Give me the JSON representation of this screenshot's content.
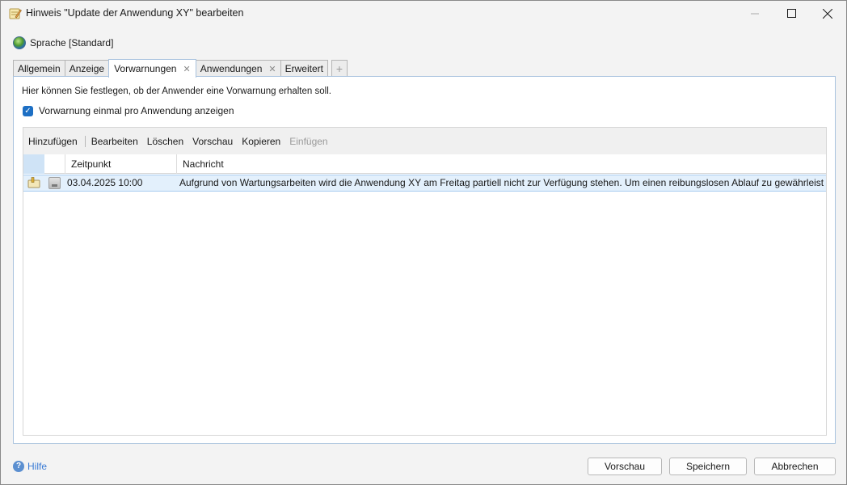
{
  "window": {
    "title": "Hinweis \"Update der Anwendung XY\" bearbeiten"
  },
  "language": {
    "label": "Sprache [Standard]"
  },
  "tabs": [
    {
      "label": "Allgemein"
    },
    {
      "label": "Anzeige"
    },
    {
      "label": "Vorwarnungen",
      "active": true,
      "closable": true
    },
    {
      "label": "Anwendungen",
      "closable": true
    },
    {
      "label": "Erweitert"
    }
  ],
  "tab_add_symbol": "+",
  "panel": {
    "hint": "Hier können Sie festlegen, ob der Anwender eine Vorwarnung erhalten soll.",
    "checkbox_label": "Vorwarnung einmal pro Anwendung anzeigen",
    "checkbox_checked": true
  },
  "toolbar": {
    "add": "Hinzufügen",
    "edit": "Bearbeiten",
    "delete": "Löschen",
    "preview": "Vorschau",
    "copy": "Kopieren",
    "paste": "Einfügen"
  },
  "table": {
    "headers": {
      "time": "Zeitpunkt",
      "message": "Nachricht"
    },
    "rows": [
      {
        "time": "03.04.2025 10:00",
        "message": "Aufgrund von Wartungsarbeiten wird die Anwendung XY am Freitag partiell nicht zur Verfügung stehen. Um einen reibungslosen Ablauf zu gewährleist...",
        "selected": true
      }
    ]
  },
  "footer": {
    "help": "Hilfe",
    "preview_button": "Vorschau",
    "save_button": "Speichern",
    "cancel_button": "Abbrechen"
  },
  "colors": {
    "accent": "#1d6fc4",
    "selection_row": "#e3f0fc",
    "link": "#3a7bd5"
  }
}
